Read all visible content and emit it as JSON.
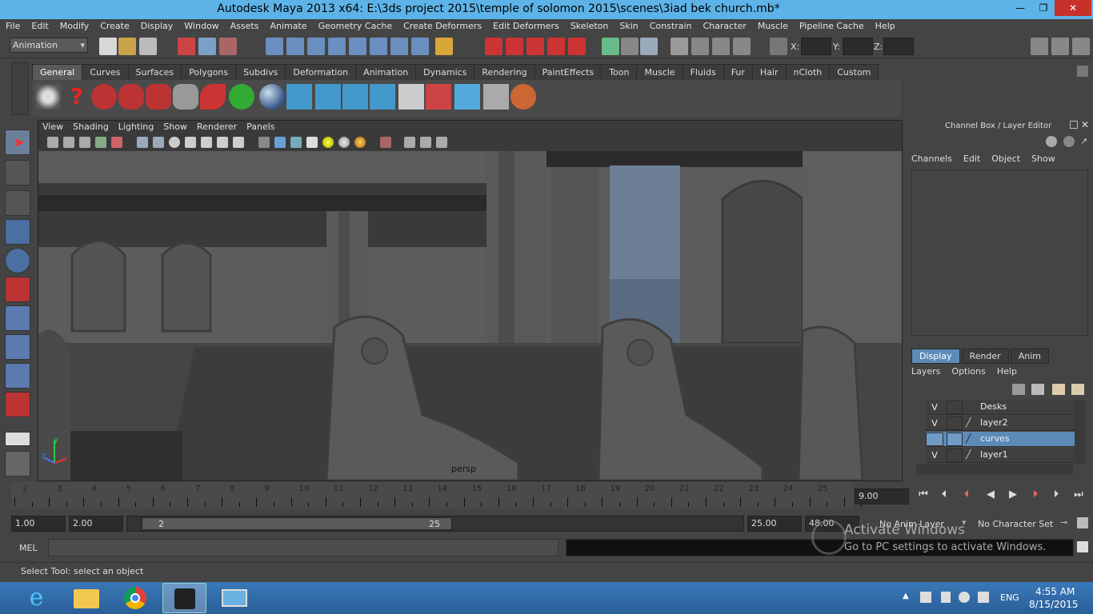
{
  "title": "Autodesk Maya 2013 x64: E:\\3ds project 2015\\temple of solomon 2015\\scenes\\3iad bek church.mb*",
  "window_controls": {
    "minimize": "—",
    "restore": "❐",
    "close": "✕"
  },
  "menus": [
    "File",
    "Edit",
    "Modify",
    "Create",
    "Display",
    "Window",
    "Assets",
    "Animate",
    "Geometry Cache",
    "Create Deformers",
    "Edit Deformers",
    "Skeleton",
    "Skin",
    "Constrain",
    "Character",
    "Muscle",
    "Pipeline Cache",
    "Help"
  ],
  "status": {
    "mode": "Animation",
    "x_label": "X:",
    "y_label": "Y:",
    "z_label": "Z:"
  },
  "shelf_tabs": [
    "General",
    "Curves",
    "Surfaces",
    "Polygons",
    "Subdivs",
    "Deformation",
    "Animation",
    "Dynamics",
    "Rendering",
    "PaintEffects",
    "Toon",
    "Muscle",
    "Fluids",
    "Fur",
    "Hair",
    "nCloth",
    "Custom"
  ],
  "viewport": {
    "menus": [
      "View",
      "Shading",
      "Lighting",
      "Show",
      "Renderer",
      "Panels"
    ],
    "camera_label": "persp",
    "axis_y": "y",
    "axis_z": "z",
    "axis_x": "x"
  },
  "channel_box": {
    "title": "Channel Box / Layer Editor",
    "menus": [
      "Channels",
      "Edit",
      "Object",
      "Show"
    ]
  },
  "layer_editor": {
    "tabs": [
      "Display",
      "Render",
      "Anim"
    ],
    "menus": [
      "Layers",
      "Options",
      "Help"
    ],
    "layers": [
      {
        "v": "V",
        "name": "Desks"
      },
      {
        "v": "V",
        "name": "layer2"
      },
      {
        "v": "",
        "name": "curves"
      },
      {
        "v": "V",
        "name": "layer1"
      }
    ]
  },
  "timeline": {
    "ticks": [
      "2",
      "3",
      "4",
      "5",
      "6",
      "7",
      "8",
      "9",
      "10",
      "11",
      "12",
      "13",
      "14",
      "15",
      "16",
      "17",
      "18",
      "19",
      "20",
      "21",
      "22",
      "23",
      "24",
      "25"
    ],
    "current_frame": "9.00"
  },
  "range": {
    "start": "1.00",
    "playback_start": "2.00",
    "slider_start": "2",
    "slider_end": "25",
    "playback_end": "25.00",
    "end": "48.00",
    "anim_layer": "No Anim Layer",
    "character_set": "No Character Set"
  },
  "cmd": {
    "label": "MEL"
  },
  "watermark": {
    "line1": "Activate Windows",
    "line2": "Go to PC settings to activate Windows."
  },
  "help_line": "Select Tool: select an object",
  "taskbar": {
    "lang": "ENG",
    "time": "4:55 AM",
    "date": "8/15/2015"
  },
  "colors": {
    "titlebar": "#5db3e8",
    "ui_bg": "#444444",
    "selected_layer": "#5d8bb8",
    "taskbar": "#2a5f98"
  }
}
